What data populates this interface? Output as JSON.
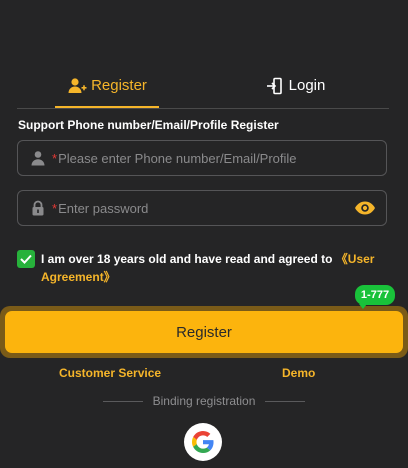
{
  "tabs": {
    "register_label": "Register",
    "login_label": "Login"
  },
  "form": {
    "section_label": "Support Phone number/Email/Profile Register",
    "account_field": {
      "value": "",
      "placeholder": "Please enter Phone number/Email/Profile",
      "required_mark": "*"
    },
    "password_field": {
      "value": "",
      "placeholder": "Enter password",
      "required_mark": "*"
    },
    "agreement": {
      "checked": true,
      "text": "I am over 18 years old and have read and agreed to ",
      "link_text": "《User Agreement》"
    },
    "register_button_label": "Register"
  },
  "promo_badge": "1-777",
  "links": {
    "customer_service": "Customer Service",
    "demo": "Demo"
  },
  "binding": {
    "label": "Binding registration"
  },
  "icons": {
    "register_tab": "user-add-icon",
    "login_tab": "login-door-icon",
    "account_field": "user-icon",
    "password_field": "lock-icon",
    "password_toggle": "eye-icon",
    "agreement_check": "checkmark-icon",
    "google": "google-icon"
  },
  "colors": {
    "background": "#252526",
    "accent": "#f5b52a",
    "button": "#fcb40d",
    "button_glow": "#7a5b18",
    "check": "#27b23b",
    "badge": "#19c23a",
    "required": "#e53935"
  }
}
